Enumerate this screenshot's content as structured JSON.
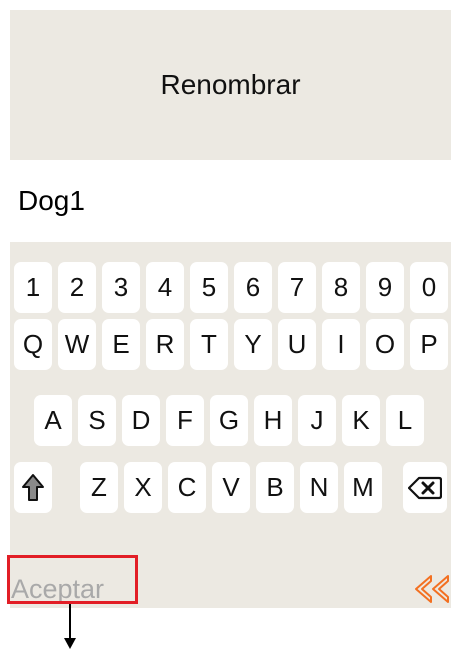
{
  "dialog": {
    "title": "Renombrar"
  },
  "name_field": {
    "value": "Dog1"
  },
  "keyboard": {
    "row1": [
      "1",
      "2",
      "3",
      "4",
      "5",
      "6",
      "7",
      "8",
      "9",
      "0"
    ],
    "row2": [
      "Q",
      "W",
      "E",
      "R",
      "T",
      "Y",
      "U",
      "I",
      "O",
      "P"
    ],
    "row3": [
      "A",
      "S",
      "D",
      "F",
      "G",
      "H",
      "J",
      "K",
      "L"
    ],
    "row4": [
      "Z",
      "X",
      "C",
      "V",
      "B",
      "N",
      "M"
    ],
    "shift_icon": "shift-up-arrow-icon",
    "backspace_icon": "backspace-icon"
  },
  "footer": {
    "accept_label": "Aceptar",
    "back_icon": "double-chevron-left-icon"
  },
  "colors": {
    "background": "#ECE9E2",
    "accent_back": "#F37021",
    "highlight": "#E21E26",
    "disabled_text": "#A9A9A9"
  }
}
